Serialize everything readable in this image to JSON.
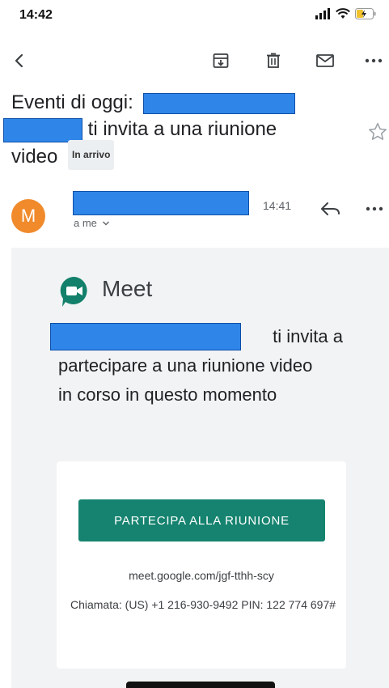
{
  "status_bar": {
    "time": "14:42"
  },
  "toolbar": {
    "icons": [
      "back-arrow-icon",
      "archive-icon",
      "delete-icon",
      "mark-unread-icon",
      "more-icon"
    ]
  },
  "email": {
    "subject_prefix": "Eventi di oggi:",
    "subject_middle": "ti invita a una riunione",
    "subject_end": "video",
    "label": "In arrivo",
    "sender_initial": "M",
    "to_me": "a me",
    "time": "14:41"
  },
  "card": {
    "app_name": "Meet",
    "invite_line1_suffix": "ti invita a",
    "invite_rest": "partecipare a una riunione video in corso in questo momento",
    "join_button": "PARTECIPA ALLA RIUNIONE",
    "meet_link": "meet.google.com/jgf-tthh-scy",
    "dial_info": "Chiamata: (US) +1 216-930-9492 PIN: 122 774 697#"
  },
  "colors": {
    "redaction": "#2f86e8",
    "avatar": "#f08a2b",
    "join_button": "#15836f",
    "card_background": "#f1f3f4"
  }
}
